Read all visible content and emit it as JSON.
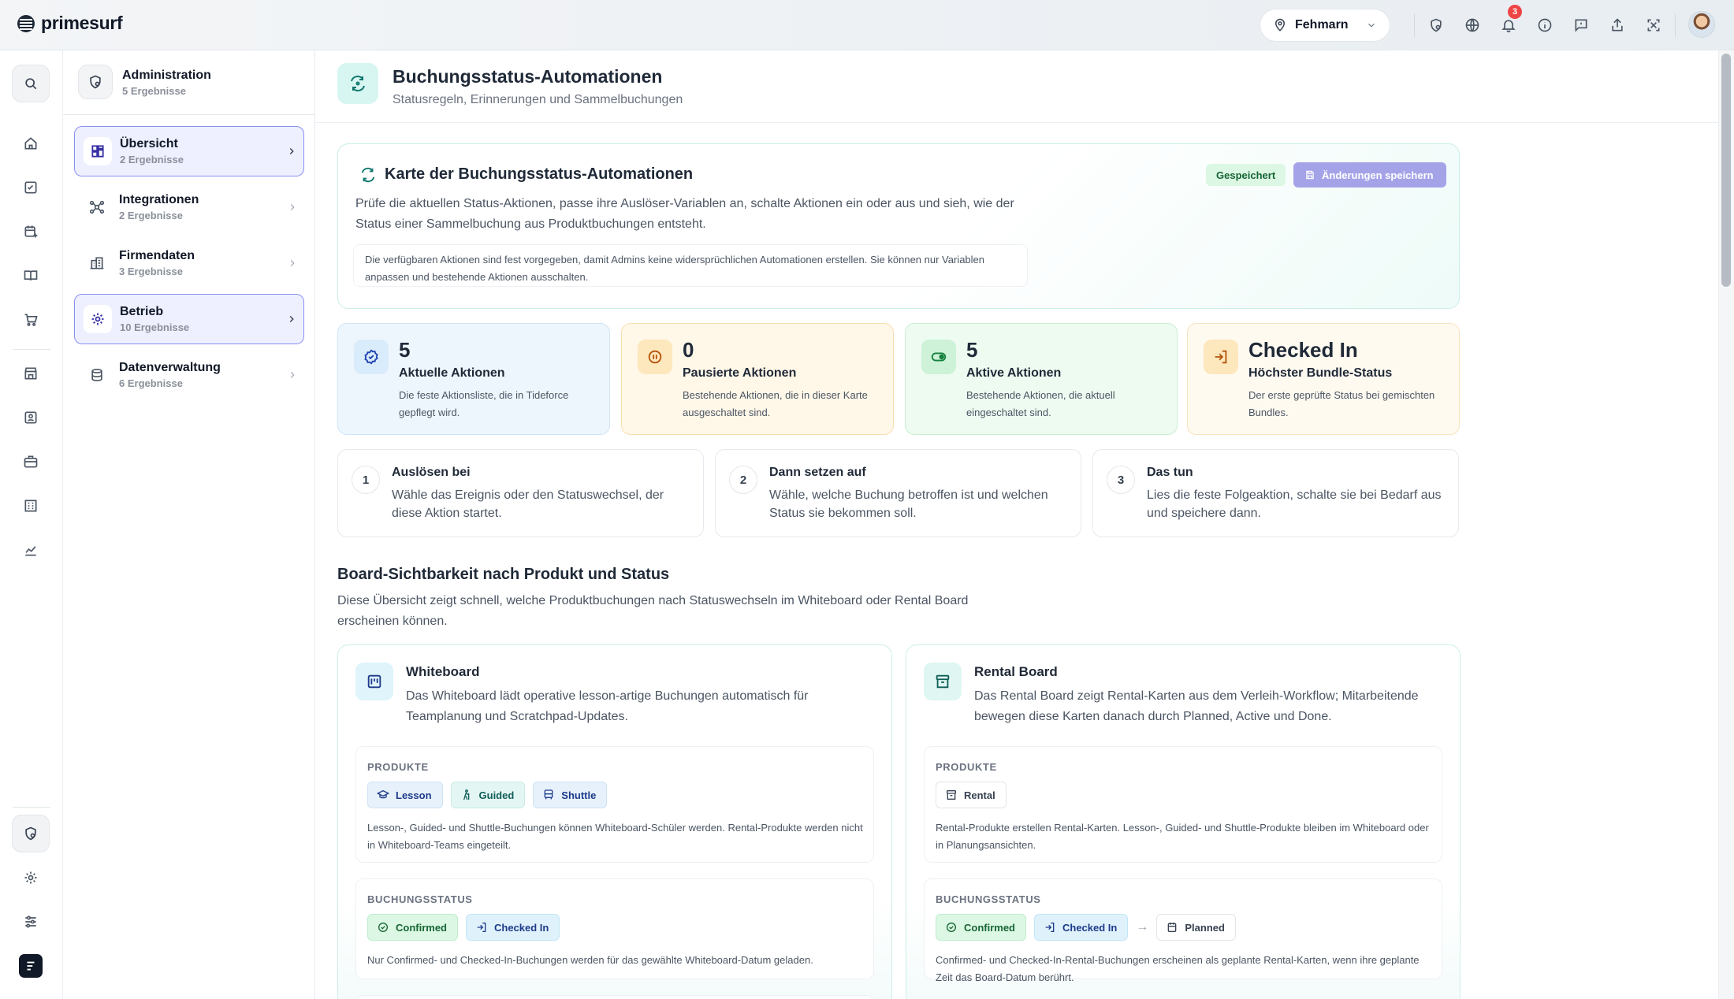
{
  "app": {
    "name": "primesurf"
  },
  "topbar": {
    "location": "Fehmarn",
    "notification_count": "3"
  },
  "nav": {
    "header": {
      "title": "Administration",
      "count": "5 Ergebnisse"
    },
    "items": [
      {
        "label": "Übersicht",
        "count": "2 Ergebnisse",
        "active": true
      },
      {
        "label": "Integrationen",
        "count": "2 Ergebnisse",
        "active": false
      },
      {
        "label": "Firmendaten",
        "count": "3 Ergebnisse",
        "active": false
      },
      {
        "label": "Betrieb",
        "count": "10 Ergebnisse",
        "active": true
      },
      {
        "label": "Datenverwaltung",
        "count": "6 Ergebnisse",
        "active": false
      }
    ]
  },
  "page": {
    "title": "Buchungsstatus-Automationen",
    "subtitle": "Statusregeln, Erinnerungen und Sammelbuchungen"
  },
  "hero": {
    "title": "Karte der Buchungsstatus-Automationen",
    "description": "Prüfe die aktuellen Status-Aktionen, passe ihre Auslöser-Variablen an, schalte Aktionen ein oder aus und sieh, wie der Status einer Sammelbuchung aus Produktbuchungen entsteht.",
    "note": "Die verfügbaren Aktionen sind fest vorgegeben, damit Admins keine widersprüchlichen Automationen erstellen. Sie können nur Variablen anpassen und bestehende Aktionen ausschalten.",
    "saved_label": "Gespeichert",
    "save_button": "Änderungen speichern"
  },
  "stats": [
    {
      "value": "5",
      "label": "Aktuelle Aktionen",
      "desc": "Die feste Aktionsliste, die in Tideforce gepflegt wird.",
      "accent": "#3b82f6"
    },
    {
      "value": "0",
      "label": "Pausierte Aktionen",
      "desc": "Bestehende Aktionen, die in dieser Karte ausgeschaltet sind.",
      "accent": "#f59e0b"
    },
    {
      "value": "5",
      "label": "Aktive Aktionen",
      "desc": "Bestehende Aktionen, die aktuell eingeschaltet sind.",
      "accent": "#22c55e"
    },
    {
      "value": "Checked In",
      "label": "Höchster Bundle-Status",
      "desc": "Der erste geprüfte Status bei gemischten Bundles.",
      "accent": "#f59e0b"
    }
  ],
  "steps": [
    {
      "number": "1",
      "title": "Auslösen bei",
      "desc": "Wähle das Ereignis oder den Statuswechsel, der diese Aktion startet."
    },
    {
      "number": "2",
      "title": "Dann setzen auf",
      "desc": "Wähle, welche Buchung betroffen ist und welchen Status sie bekommen soll."
    },
    {
      "number": "3",
      "title": "Das tun",
      "desc": "Lies die feste Folgeaktion, schalte sie bei Bedarf aus und speichere dann."
    }
  ],
  "visibility": {
    "title": "Board-Sichtbarkeit nach Produkt und Status",
    "desc": "Diese Übersicht zeigt schnell, welche Produktbuchungen nach Statuswechseln im Whiteboard oder Rental Board erscheinen können."
  },
  "boards": [
    {
      "title": "Whiteboard",
      "desc": "Das Whiteboard lädt operative lesson-artige Buchungen automatisch für Teamplanung und Scratchpad-Updates.",
      "products_label": "PRODUKTE",
      "products": [
        "Lesson",
        "Guided",
        "Shuttle"
      ],
      "products_note": "Lesson-, Guided- und Shuttle-Buchungen können Whiteboard-Schüler werden. Rental-Produkte werden nicht in Whiteboard-Teams eingeteilt.",
      "status_label": "BUCHUNGSSTATUS",
      "statuses": [
        "Confirmed",
        "Checked In"
      ],
      "status_note": "Nur Confirmed- und Checked-In-Buchungen werden für das gewählte Whiteboard-Datum geladen."
    },
    {
      "title": "Rental Board",
      "desc": "Das Rental Board zeigt Rental-Karten aus dem Verleih-Workflow; Mitarbeitende bewegen diese Karten danach durch Planned, Active und Done.",
      "products_label": "PRODUKTE",
      "products": [
        "Rental"
      ],
      "products_note": "Rental-Produkte erstellen Rental-Karten. Lesson-, Guided- und Shuttle-Produkte bleiben im Whiteboard oder in Planungsansichten.",
      "status_label": "BUCHUNGSSTATUS",
      "statuses": [
        "Confirmed",
        "Checked In"
      ],
      "status_target": "Planned",
      "status_note": "Confirmed- und Checked-In-Rental-Buchungen erscheinen als geplante Rental-Karten, wenn ihre geplante Zeit das Board-Datum berührt."
    }
  ]
}
